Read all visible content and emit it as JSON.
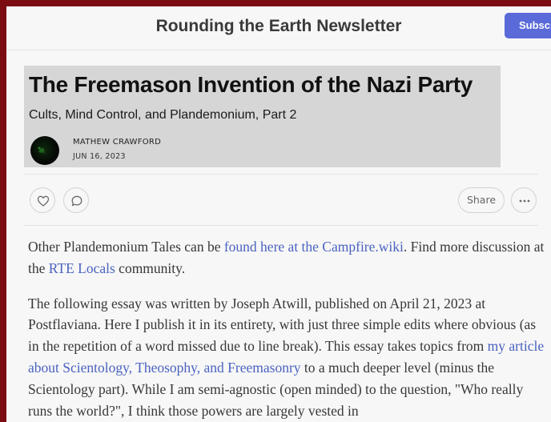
{
  "header": {
    "publication_title": "Rounding the Earth Newsletter",
    "subscribe_label": "Subscribe"
  },
  "post": {
    "title": "The Freemason Invention of the Nazi Party",
    "subtitle": "Cults, Mind Control, and Plandemonium, Part 2",
    "author": "MATHEW CRAWFORD",
    "date": "JUN 16, 2023"
  },
  "actions": {
    "like_icon": "heart-icon",
    "comment_icon": "comment-icon",
    "share_label": "Share",
    "more_icon": "more-icon"
  },
  "body": {
    "p1_a": "Other Plandemonium Tales can be ",
    "p1_link1": "found here at the Campfire.wiki",
    "p1_b": ". Find more discussion at the ",
    "p1_link2": "RTE Locals",
    "p1_c": " community.",
    "p2_a": "The following essay was written by Joseph Atwill, published on April 21, 2023 at Postflaviana. Here I publish it in its entirety, with just three simple edits where obvious (as in the repetition of a word missed due to line break). This essay takes topics from ",
    "p2_link": "my article about Scientology, Theosophy, and Freemasonry",
    "p2_b": " to a much deeper level (minus the Scientology part). While I am semi-agnostic (open minded) to the question, \"Who really runs the world?\", I think those powers are largely vested in"
  },
  "colors": {
    "frame": "#7a0c12",
    "accent": "#5a6ad8",
    "link": "#4a62c0"
  }
}
